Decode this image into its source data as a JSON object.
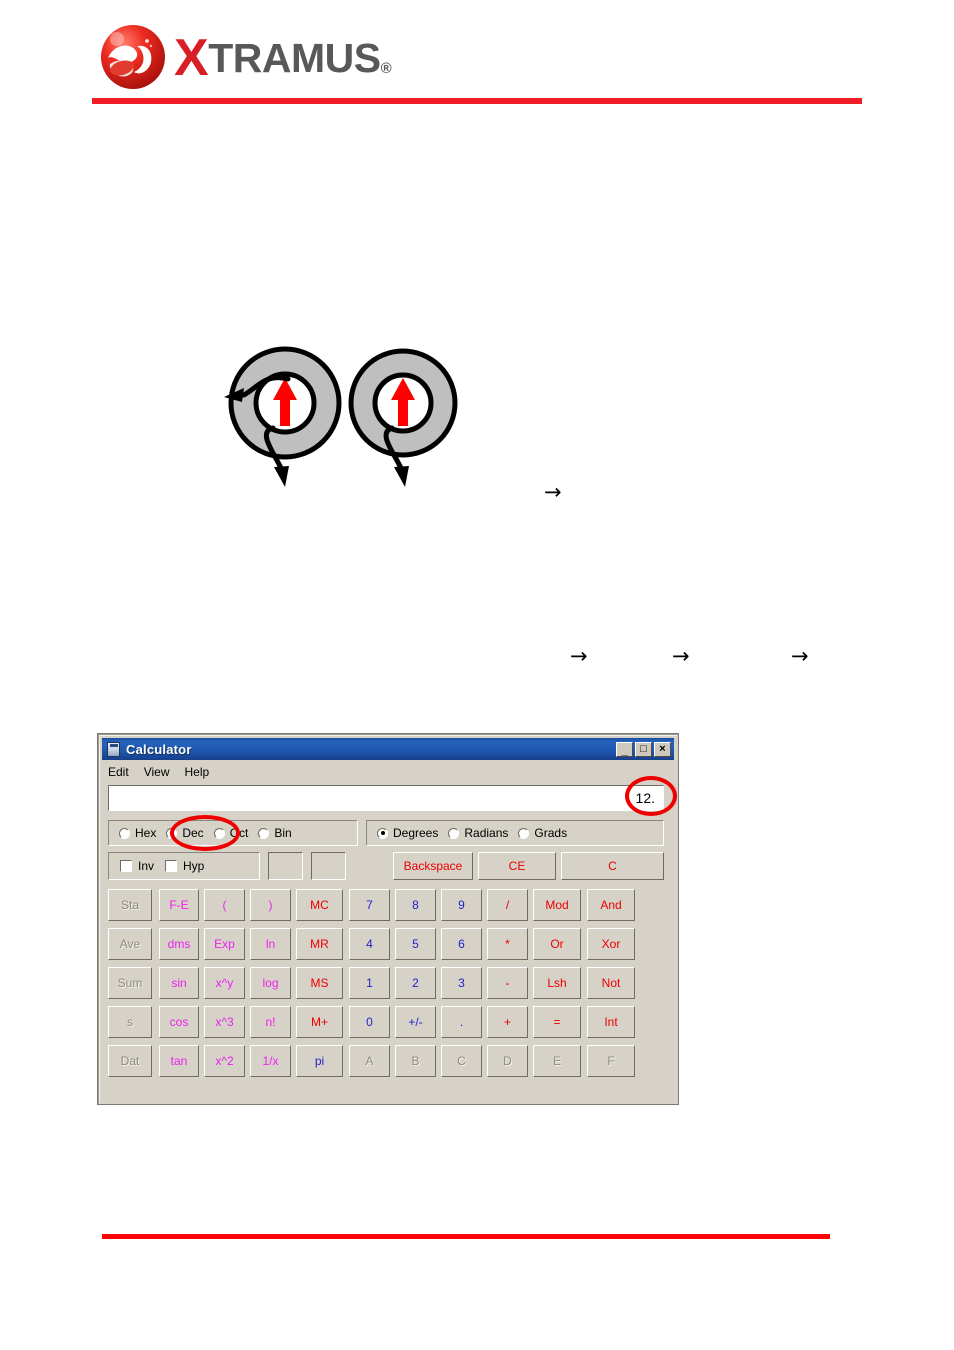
{
  "document": {
    "brand": {
      "logo_mark": "xtramus-logo-mark",
      "wordmark_x": "X",
      "wordmark_rest": "TRAMUS",
      "registered_mark": "®"
    },
    "header_rule_color": "#ee1c25",
    "footer_rule_color": "#fd0000"
  },
  "figure": {
    "name": "two-ring-torus-diagram",
    "ring_fill": "#bfbfbf",
    "ring_stroke": "#000000",
    "inner_arrow_color": "#ff0000",
    "ring_count": 2
  },
  "inline_arrows": {
    "arrow_1": "→",
    "arrow_2": "→",
    "arrow_3": "→",
    "arrow_4": "→"
  },
  "calculator": {
    "title": "Calculator",
    "window_buttons": {
      "minimize": "_",
      "maximize": "□",
      "close": "×"
    },
    "menu": [
      {
        "label": "Edit"
      },
      {
        "label": "View"
      },
      {
        "label": "Help"
      }
    ],
    "display": {
      "value": "12.",
      "placeholder": ""
    },
    "number_base": {
      "selected": "Dec",
      "options": [
        {
          "label": "Hex",
          "checked": false
        },
        {
          "label": "Dec",
          "checked": true
        },
        {
          "label": "Oct",
          "checked": false
        },
        {
          "label": "Bin",
          "checked": false
        }
      ]
    },
    "angle_unit": {
      "selected": "Degrees",
      "options": [
        {
          "label": "Degrees",
          "checked": true
        },
        {
          "label": "Radians",
          "checked": false
        },
        {
          "label": "Grads",
          "checked": false
        }
      ]
    },
    "modifiers": [
      {
        "label": "Inv",
        "checked": false
      },
      {
        "label": "Hyp",
        "checked": false
      }
    ],
    "indicators": [
      {
        "label": ""
      },
      {
        "label": ""
      }
    ],
    "clear_keys": [
      {
        "label": "Backspace",
        "color": "#ee0000"
      },
      {
        "label": "CE",
        "color": "#ee0000"
      },
      {
        "label": "C",
        "color": "#ee0000"
      }
    ],
    "keypad": {
      "rows": [
        [
          {
            "label": "Sta",
            "color": "#2222cc",
            "disabled": true
          },
          {
            "label": "F-E",
            "color": "#ee22ee",
            "disabled": false
          },
          {
            "label": "(",
            "color": "#ee22ee",
            "disabled": false
          },
          {
            "label": ")",
            "color": "#ee22ee",
            "disabled": false
          },
          {
            "label": "MC",
            "color": "#ee0000",
            "disabled": false
          },
          {
            "label": "7",
            "color": "#2222cc",
            "disabled": false
          },
          {
            "label": "8",
            "color": "#2222cc",
            "disabled": false
          },
          {
            "label": "9",
            "color": "#2222cc",
            "disabled": false
          },
          {
            "label": "/",
            "color": "#ee0000",
            "disabled": false
          },
          {
            "label": "Mod",
            "color": "#ee0000",
            "disabled": false
          },
          {
            "label": "And",
            "color": "#ee0000",
            "disabled": false
          }
        ],
        [
          {
            "label": "Ave",
            "color": "#2222cc",
            "disabled": true
          },
          {
            "label": "dms",
            "color": "#ee22ee",
            "disabled": false
          },
          {
            "label": "Exp",
            "color": "#ee22ee",
            "disabled": false
          },
          {
            "label": "ln",
            "color": "#ee22ee",
            "disabled": false
          },
          {
            "label": "MR",
            "color": "#ee0000",
            "disabled": false
          },
          {
            "label": "4",
            "color": "#2222cc",
            "disabled": false
          },
          {
            "label": "5",
            "color": "#2222cc",
            "disabled": false
          },
          {
            "label": "6",
            "color": "#2222cc",
            "disabled": false
          },
          {
            "label": "*",
            "color": "#ee0000",
            "disabled": false
          },
          {
            "label": "Or",
            "color": "#ee0000",
            "disabled": false
          },
          {
            "label": "Xor",
            "color": "#ee0000",
            "disabled": false
          }
        ],
        [
          {
            "label": "Sum",
            "color": "#2222cc",
            "disabled": true
          },
          {
            "label": "sin",
            "color": "#ee22ee",
            "disabled": false
          },
          {
            "label": "x^y",
            "color": "#ee22ee",
            "disabled": false
          },
          {
            "label": "log",
            "color": "#ee22ee",
            "disabled": false
          },
          {
            "label": "MS",
            "color": "#ee0000",
            "disabled": false
          },
          {
            "label": "1",
            "color": "#2222cc",
            "disabled": false
          },
          {
            "label": "2",
            "color": "#2222cc",
            "disabled": false
          },
          {
            "label": "3",
            "color": "#2222cc",
            "disabled": false
          },
          {
            "label": "-",
            "color": "#ee0000",
            "disabled": false
          },
          {
            "label": "Lsh",
            "color": "#ee0000",
            "disabled": false
          },
          {
            "label": "Not",
            "color": "#ee0000",
            "disabled": false
          }
        ],
        [
          {
            "label": "s",
            "color": "#2222cc",
            "disabled": true
          },
          {
            "label": "cos",
            "color": "#ee22ee",
            "disabled": false
          },
          {
            "label": "x^3",
            "color": "#ee22ee",
            "disabled": false
          },
          {
            "label": "n!",
            "color": "#ee22ee",
            "disabled": false
          },
          {
            "label": "M+",
            "color": "#ee0000",
            "disabled": false
          },
          {
            "label": "0",
            "color": "#2222cc",
            "disabled": false
          },
          {
            "label": "+/-",
            "color": "#2222cc",
            "disabled": false
          },
          {
            "label": ".",
            "color": "#2222cc",
            "disabled": false
          },
          {
            "label": "+",
            "color": "#ee0000",
            "disabled": false
          },
          {
            "label": "=",
            "color": "#ee0000",
            "disabled": false
          },
          {
            "label": "Int",
            "color": "#ee0000",
            "disabled": false
          }
        ],
        [
          {
            "label": "Dat",
            "color": "#2222cc",
            "disabled": true
          },
          {
            "label": "tan",
            "color": "#ee22ee",
            "disabled": false
          },
          {
            "label": "x^2",
            "color": "#ee22ee",
            "disabled": false
          },
          {
            "label": "1/x",
            "color": "#ee22ee",
            "disabled": false
          },
          {
            "label": "pi",
            "color": "#2222cc",
            "disabled": false
          },
          {
            "label": "A",
            "color": "#2222cc",
            "disabled": true
          },
          {
            "label": "B",
            "color": "#2222cc",
            "disabled": true
          },
          {
            "label": "C",
            "color": "#2222cc",
            "disabled": true
          },
          {
            "label": "D",
            "color": "#2222cc",
            "disabled": true
          },
          {
            "label": "E",
            "color": "#2222cc",
            "disabled": true
          },
          {
            "label": "F",
            "color": "#2222cc",
            "disabled": true
          }
        ]
      ]
    }
  },
  "annotations": [
    {
      "name": "display-value-highlight",
      "shape": "ellipse",
      "color": "#ef0000"
    },
    {
      "name": "dec-radio-highlight",
      "shape": "ellipse",
      "color": "#ef0000"
    }
  ]
}
